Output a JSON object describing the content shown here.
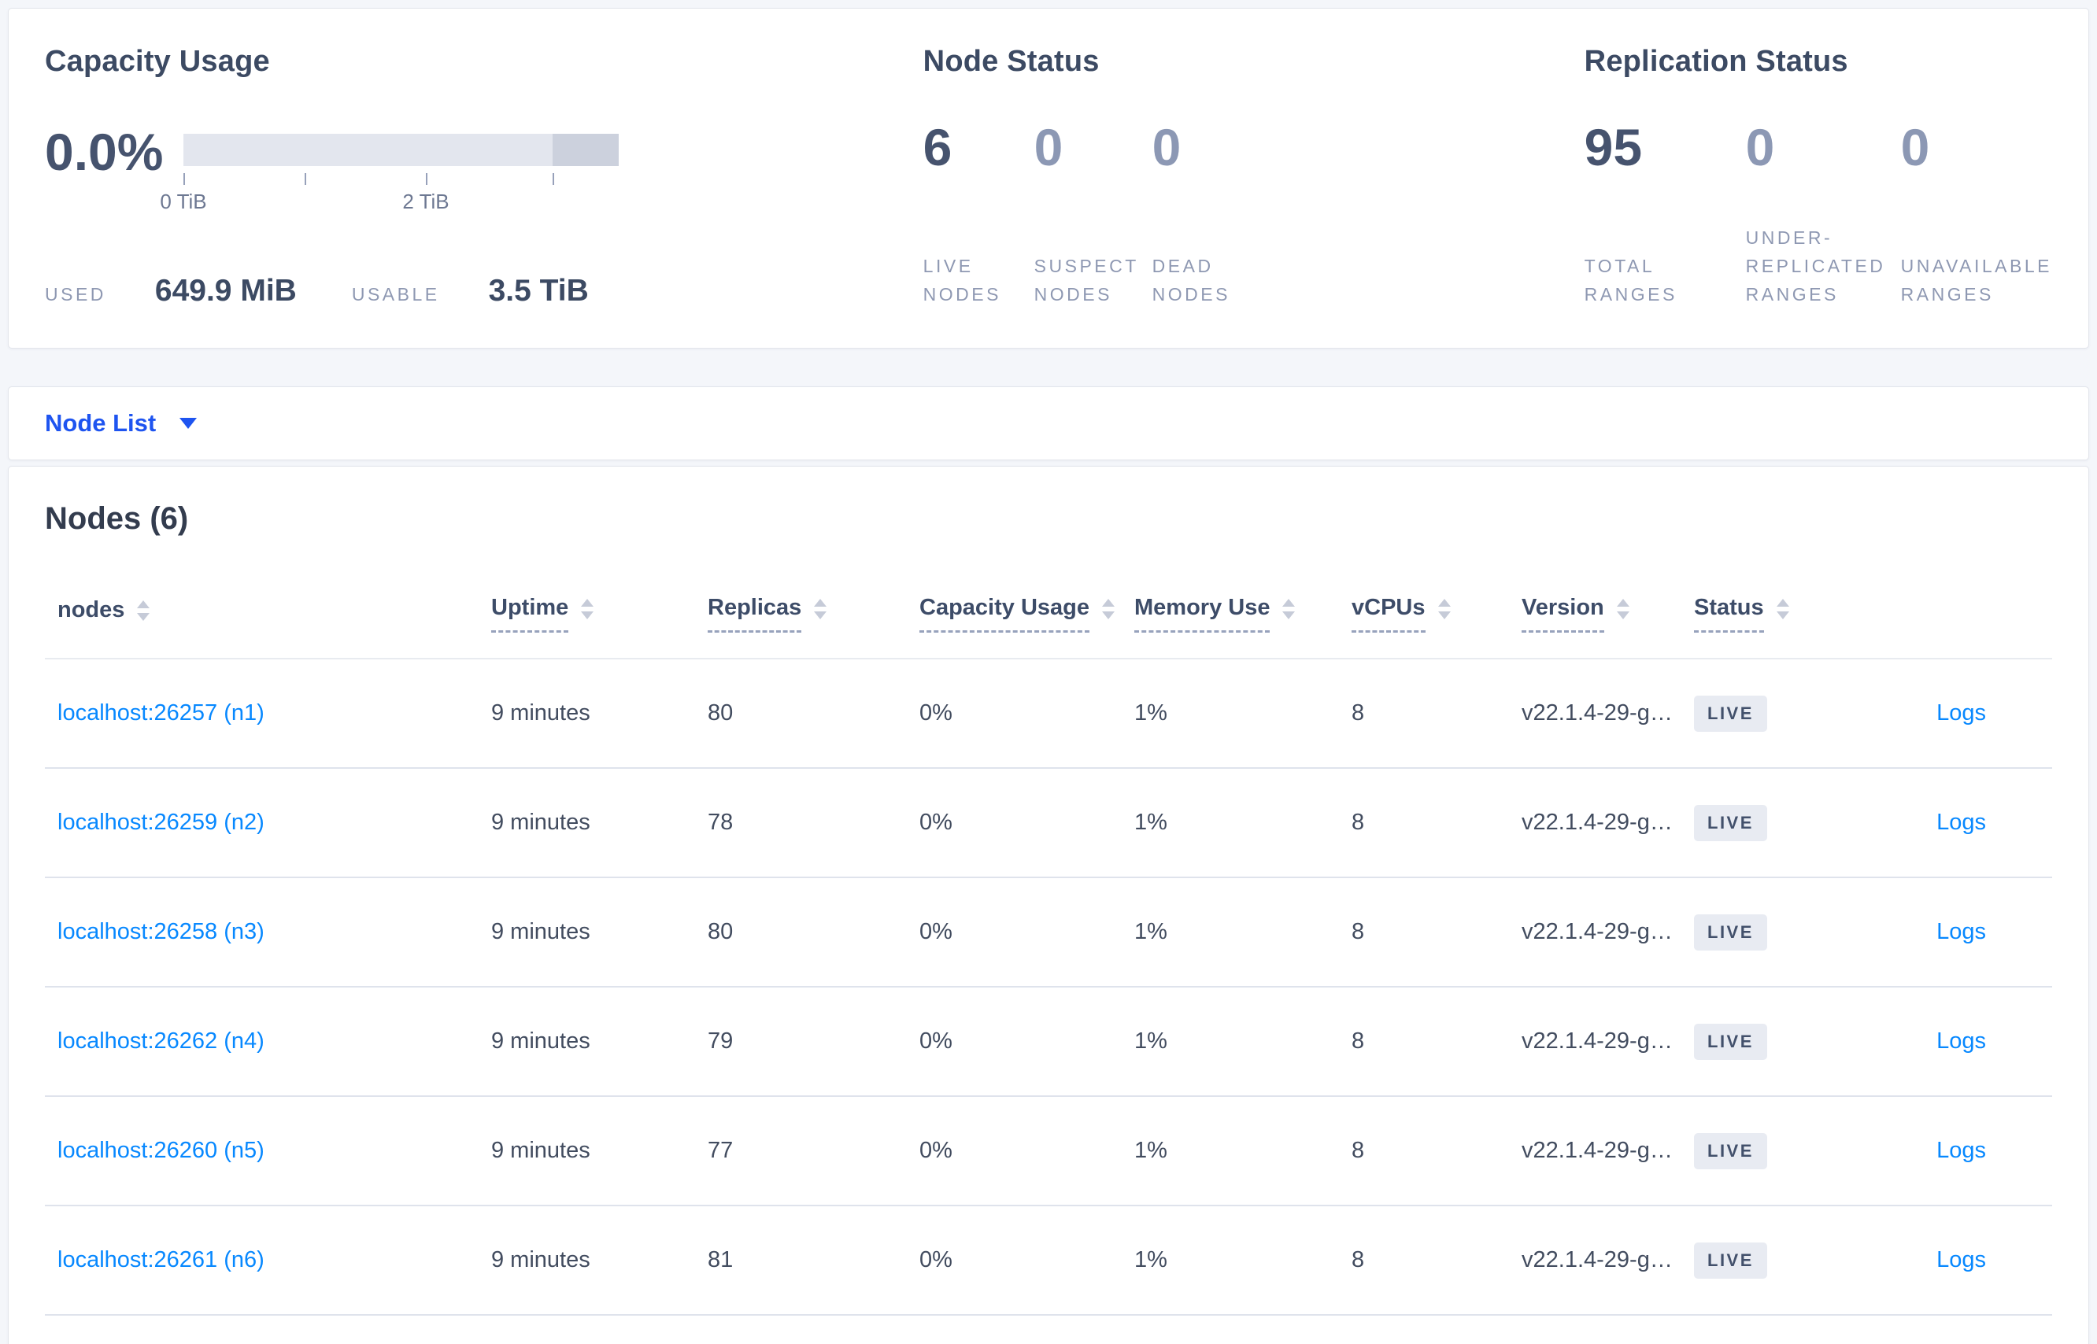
{
  "colors": {
    "accent_blue": "#1e54f0",
    "link_blue": "#0788ff",
    "dark_text": "#3c4a63",
    "muted_label": "#8e98b2",
    "badge_bg": "#e8ebf2",
    "bar_track": "#e3e6ee",
    "bar_cap": "#ccd1dd"
  },
  "summary": {
    "capacity": {
      "title": "Capacity Usage",
      "percent": "0.0%",
      "tick_label_0": "0 TiB",
      "tick_label_2": "2 TiB",
      "used_label": "USED",
      "used_value": "649.9 MiB",
      "usable_label": "USABLE",
      "usable_value": "3.5 TiB"
    },
    "node_status": {
      "title": "Node Status",
      "stats": [
        {
          "value": "6",
          "label": "LIVE\nNODES"
        },
        {
          "value": "0",
          "label": "SUSPECT\nNODES"
        },
        {
          "value": "0",
          "label": "DEAD\nNODES"
        }
      ]
    },
    "replication_status": {
      "title": "Replication Status",
      "stats": [
        {
          "value": "95",
          "label": "TOTAL\nRANGES"
        },
        {
          "value": "0",
          "label": "UNDER-\nREPLICATED\nRANGES"
        },
        {
          "value": "0",
          "label": "UNAVAILABLE\nRANGES"
        }
      ]
    }
  },
  "view_selector": {
    "label": "Node List"
  },
  "table": {
    "title": "Nodes (6)",
    "columns": [
      {
        "label": "nodes"
      },
      {
        "label": "Uptime"
      },
      {
        "label": "Replicas"
      },
      {
        "label": "Capacity Usage"
      },
      {
        "label": "Memory Use"
      },
      {
        "label": "vCPUs"
      },
      {
        "label": "Version"
      },
      {
        "label": "Status"
      }
    ],
    "rows": [
      {
        "node": "localhost:26257 (n1)",
        "uptime": "9 minutes",
        "replicas": "80",
        "capacity": "0%",
        "memory": "1%",
        "vcpus": "8",
        "version": "v22.1.4-29-g…",
        "status": "LIVE",
        "logs": "Logs"
      },
      {
        "node": "localhost:26259 (n2)",
        "uptime": "9 minutes",
        "replicas": "78",
        "capacity": "0%",
        "memory": "1%",
        "vcpus": "8",
        "version": "v22.1.4-29-g…",
        "status": "LIVE",
        "logs": "Logs"
      },
      {
        "node": "localhost:26258 (n3)",
        "uptime": "9 minutes",
        "replicas": "80",
        "capacity": "0%",
        "memory": "1%",
        "vcpus": "8",
        "version": "v22.1.4-29-g…",
        "status": "LIVE",
        "logs": "Logs"
      },
      {
        "node": "localhost:26262 (n4)",
        "uptime": "9 minutes",
        "replicas": "79",
        "capacity": "0%",
        "memory": "1%",
        "vcpus": "8",
        "version": "v22.1.4-29-g…",
        "status": "LIVE",
        "logs": "Logs"
      },
      {
        "node": "localhost:26260 (n5)",
        "uptime": "9 minutes",
        "replicas": "77",
        "capacity": "0%",
        "memory": "1%",
        "vcpus": "8",
        "version": "v22.1.4-29-g…",
        "status": "LIVE",
        "logs": "Logs"
      },
      {
        "node": "localhost:26261 (n6)",
        "uptime": "9 minutes",
        "replicas": "81",
        "capacity": "0%",
        "memory": "1%",
        "vcpus": "8",
        "version": "v22.1.4-29-g…",
        "status": "LIVE",
        "logs": "Logs"
      }
    ]
  }
}
